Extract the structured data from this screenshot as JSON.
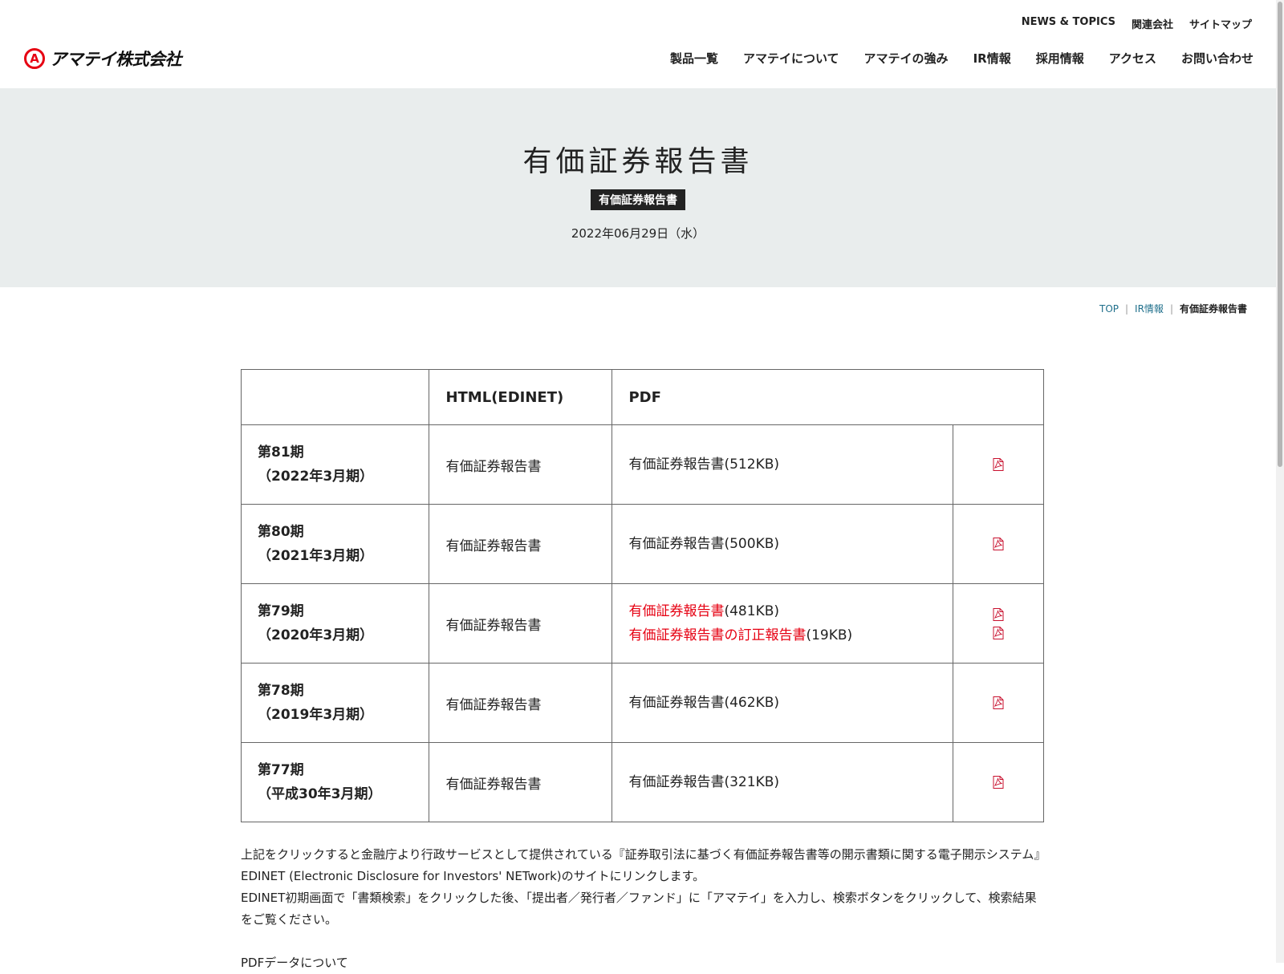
{
  "header": {
    "logo_text": "アマテイ株式会社",
    "subnav": [
      "NEWS & TOPICS",
      "関連会社",
      "サイトマップ"
    ],
    "mainnav": [
      "製品一覧",
      "アマテイについて",
      "アマテイの強み",
      "IR情報",
      "採用情報",
      "アクセス",
      "お問い合わせ"
    ]
  },
  "hero": {
    "title": "有価証券報告書",
    "tag": "有価証券報告書",
    "date": "2022年06月29日（水）"
  },
  "breadcrumb": {
    "items": [
      "TOP",
      "IR情報"
    ],
    "current": "有価証券報告書"
  },
  "table": {
    "headers": [
      "",
      "HTML(EDINET)",
      "PDF"
    ],
    "rows": [
      {
        "period": "第81期",
        "fiscal": "（2022年3月期）",
        "html": "有価証券報告書",
        "pdfs": [
          {
            "label": "有価証券報告書",
            "size": "(512KB)"
          }
        ]
      },
      {
        "period": "第80期",
        "fiscal": "（2021年3月期）",
        "html": "有価証券報告書",
        "pdfs": [
          {
            "label": "有価証券報告書",
            "size": "(500KB)"
          }
        ]
      },
      {
        "period": "第79期",
        "fiscal": "（2020年3月期）",
        "html": "有価証券報告書",
        "pdfs": [
          {
            "label": "有価証券報告書",
            "size": "(481KB)",
            "highlight": true
          },
          {
            "label": "有価証券報告書の訂正報告書",
            "size": "(19KB)",
            "highlight": true
          }
        ]
      },
      {
        "period": "第78期",
        "fiscal": "（2019年3月期）",
        "html": "有価証券報告書",
        "pdfs": [
          {
            "label": "有価証券報告書",
            "size": "(462KB)"
          }
        ]
      },
      {
        "period": "第77期",
        "fiscal": "（平成30年3月期）",
        "html": "有価証券報告書",
        "pdfs": [
          {
            "label": "有価証券報告書",
            "size": "(321KB)"
          }
        ]
      }
    ]
  },
  "notes": {
    "p1": "上記をクリックすると金融庁より行政サービスとして提供されている『証券取引法に基づく有価証券報告書等の開示書類に関する電子開示システム』EDINET (Electronic Disclosure for Investors' NETwork)のサイトにリンクします。",
    "p2": "EDINET初期画面で「書類検索」をクリックした後、「提出者／発行者／ファンド」に「アマテイ」を入力し、検索ボタンをクリックして、検索結果をご覧ください。",
    "p3": "PDFデータについて"
  },
  "colors": {
    "accent": "#e60012",
    "hero_bg": "#e9eded",
    "link": "#1f6f8b"
  },
  "icons": {
    "pdf": "pdf-icon",
    "logo": "amatei-logo-icon"
  }
}
